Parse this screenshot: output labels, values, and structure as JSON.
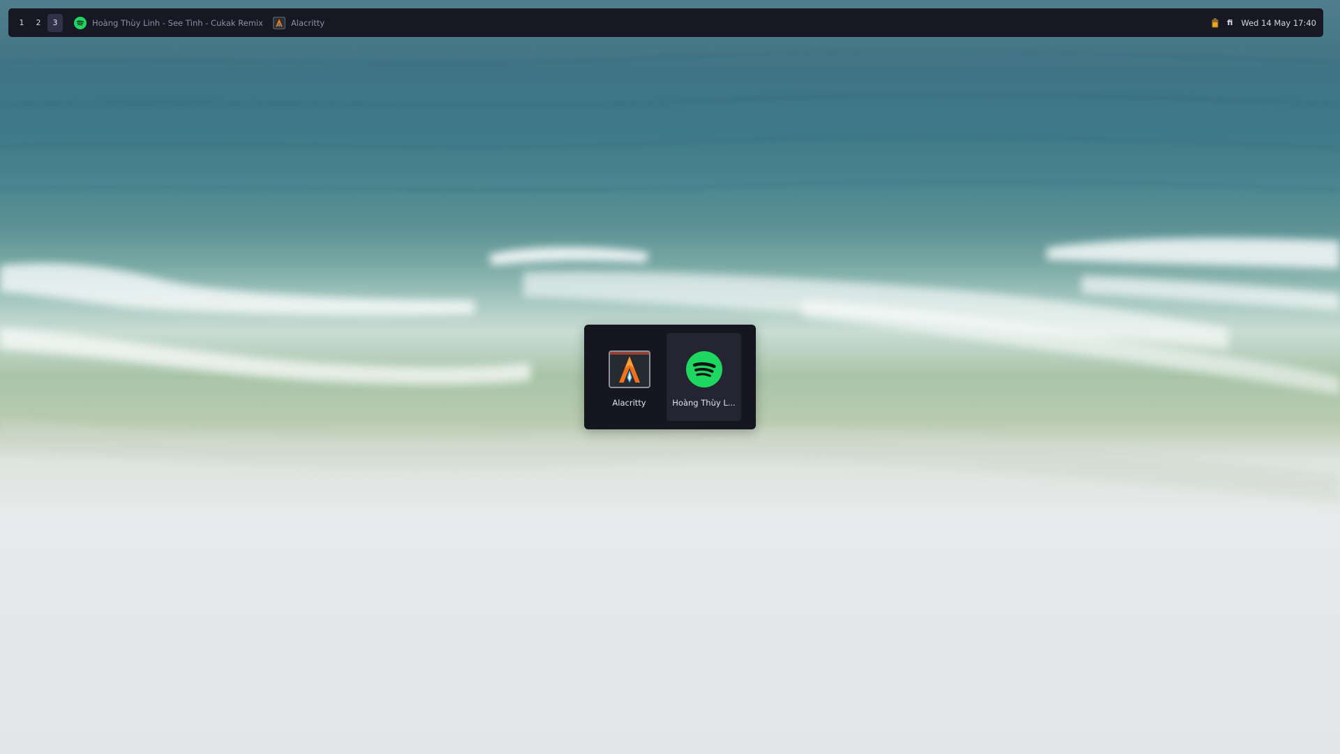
{
  "topbar": {
    "workspaces": [
      {
        "label": "1",
        "active": false
      },
      {
        "label": "2",
        "active": false
      },
      {
        "label": "3",
        "active": true
      }
    ],
    "tasks": [
      {
        "label": "Hoàng Thùy Linh - See Tình - Cukak Remix",
        "icon": "spotify-icon"
      },
      {
        "label": "Alacritty",
        "icon": "alacritty-icon"
      }
    ],
    "tray": {
      "battery_icon": "battery-icon",
      "keyboard_layout": "fi"
    },
    "clock": "Wed 14 May 17:40"
  },
  "switcher": {
    "items": [
      {
        "label": "Alacritty",
        "icon": "alacritty-icon",
        "selected": false
      },
      {
        "label": "Hoàng Thùy L...",
        "icon": "spotify-icon",
        "selected": true
      }
    ]
  },
  "colors": {
    "bar_bg": "#181824",
    "spotify_green": "#1ed760",
    "accent_orange": "#f07a1e"
  }
}
